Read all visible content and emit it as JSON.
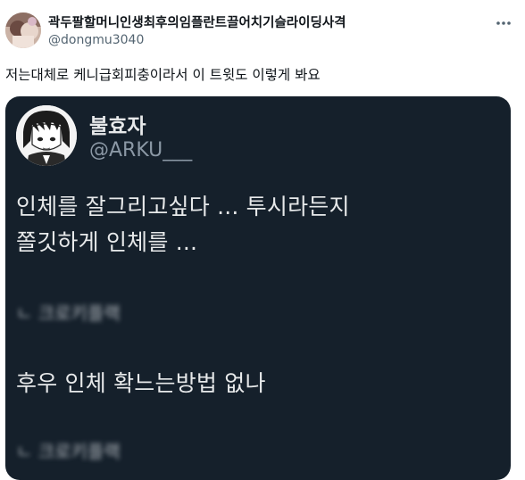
{
  "tweet": {
    "author_name": "곽두팔할머니인생최후의임플란트끌어치기슬라이딩사격",
    "author_handle": "@dongmu3040",
    "more_icon": "more-horizontal-icon",
    "text": "저는대체로 케니급회피충이라서 이 트윗도 이렇게 봐요"
  },
  "embedded": {
    "author_name": "불효자",
    "author_handle": "@ARKU___",
    "line1": "인체를 잘그리고싶다 ... 투시라든지",
    "line2": "쫄깃하게 인체를 ...",
    "quote1": "ㄴ 크로키플랙",
    "line3": "후우 인체 확느는방법 없나",
    "quote2": "ㄴ 크로키플랙"
  },
  "colors": {
    "embed_bg": "#15202b",
    "text_primary": "#0f1419",
    "text_secondary": "#536471",
    "embed_text": "#e7e9ea",
    "embed_secondary": "#8b98a5"
  }
}
